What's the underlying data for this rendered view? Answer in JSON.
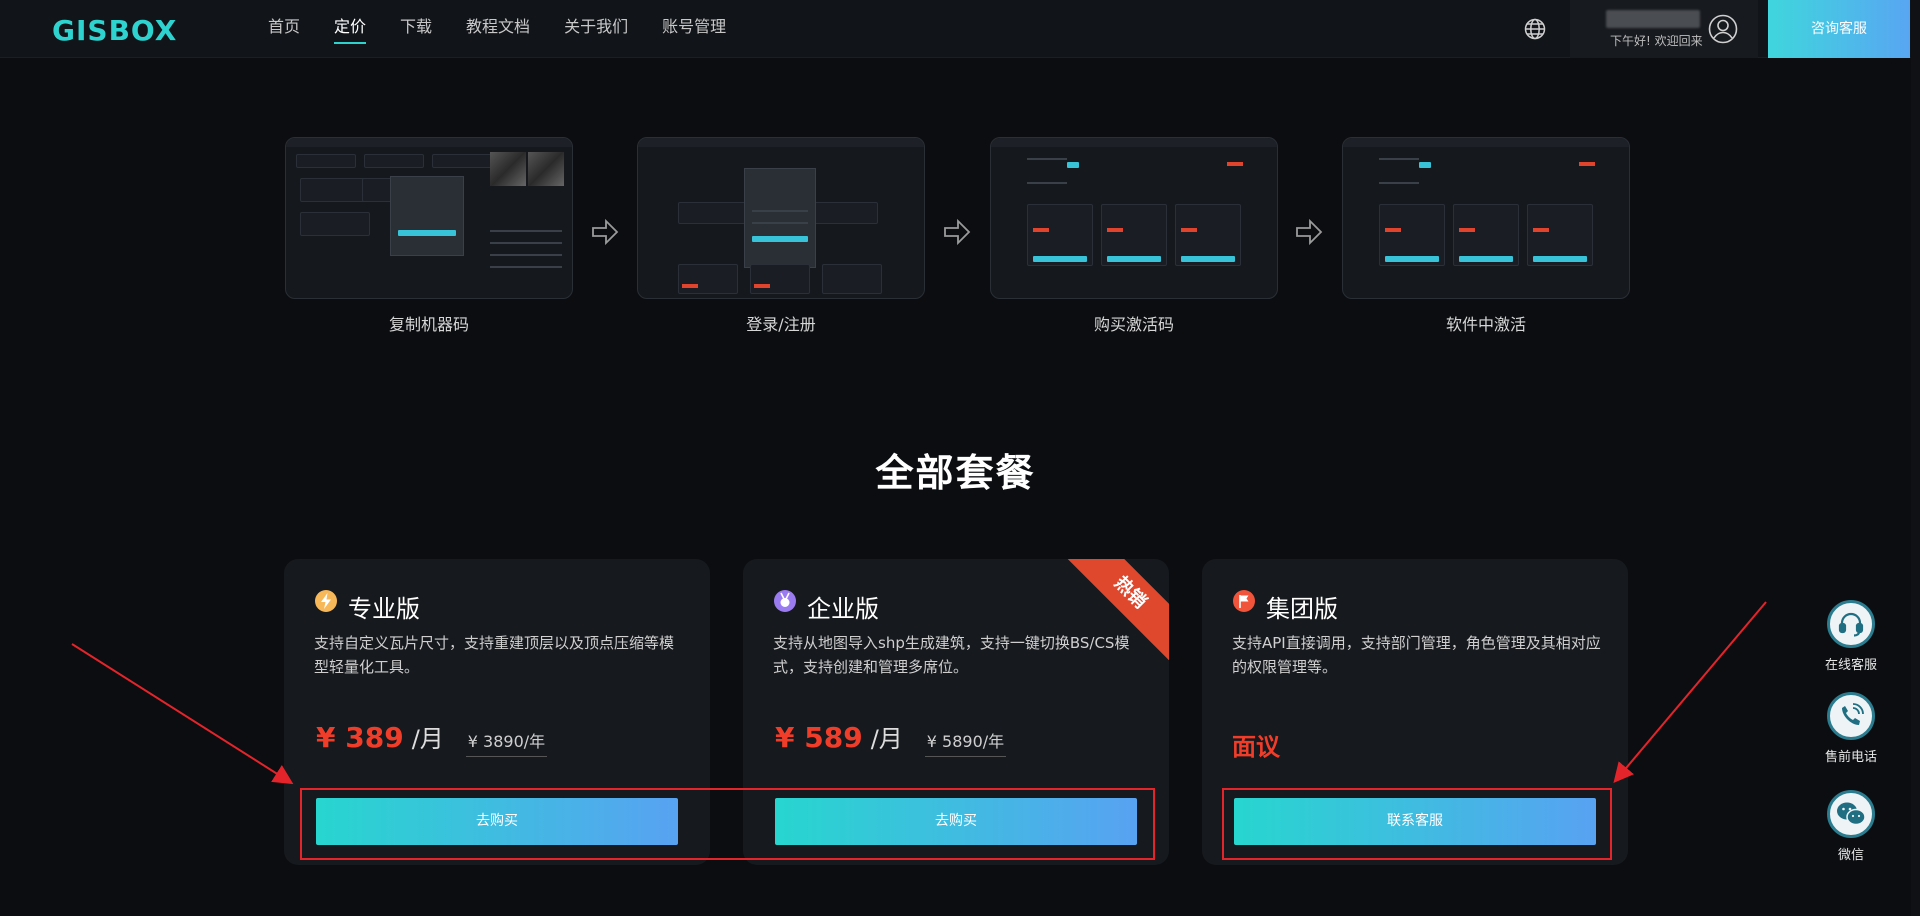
{
  "header": {
    "logo": "GISBOX",
    "nav": [
      {
        "label": "首页",
        "active": false
      },
      {
        "label": "定价",
        "active": true
      },
      {
        "label": "下载",
        "active": false
      },
      {
        "label": "教程文档",
        "active": false
      },
      {
        "label": "关于我们",
        "active": false
      },
      {
        "label": "账号管理",
        "active": false
      }
    ],
    "greeting": "下午好! 欢迎回来",
    "consult_label": "咨询客服",
    "accent": "#2ed3d0"
  },
  "steps": [
    {
      "label": "复制机器码"
    },
    {
      "label": "登录/注册"
    },
    {
      "label": "购买激活码"
    },
    {
      "label": "软件中激活"
    }
  ],
  "section_title": "全部套餐",
  "plans": [
    {
      "name": "专业版",
      "icon": "lightning-icon",
      "desc": "支持自定义瓦片尺寸，支持重建顶层以及顶点压缩等模型轻量化工具。",
      "price": "¥ 389",
      "unit": "/月",
      "year_price": "¥ 3890/年",
      "button": "去购买"
    },
    {
      "name": "企业版",
      "icon": "medal-icon",
      "desc": "支持从地图导入shp生成建筑，支持一键切换BS/CS模式，支持创建和管理多席位。",
      "price": "¥ 589",
      "unit": "/月",
      "year_price": "¥ 5890/年",
      "button": "去购买",
      "badge": "热销"
    },
    {
      "name": "集团版",
      "icon": "flag-icon",
      "desc": "支持API直接调用，支持部门管理，角色管理及其相对应的权限管理等。",
      "price": "面议",
      "button": "联系客服"
    }
  ],
  "float_bar": [
    {
      "label": "在线客服",
      "icon": "headset-icon"
    },
    {
      "label": "售前电话",
      "icon": "phone-icon"
    },
    {
      "label": "微信",
      "icon": "wechat-icon"
    }
  ],
  "colors": {
    "price_red": "#f03d2a",
    "button_start": "#27d6cf",
    "button_end": "#58a2f2",
    "annotation": "#e4242b"
  }
}
